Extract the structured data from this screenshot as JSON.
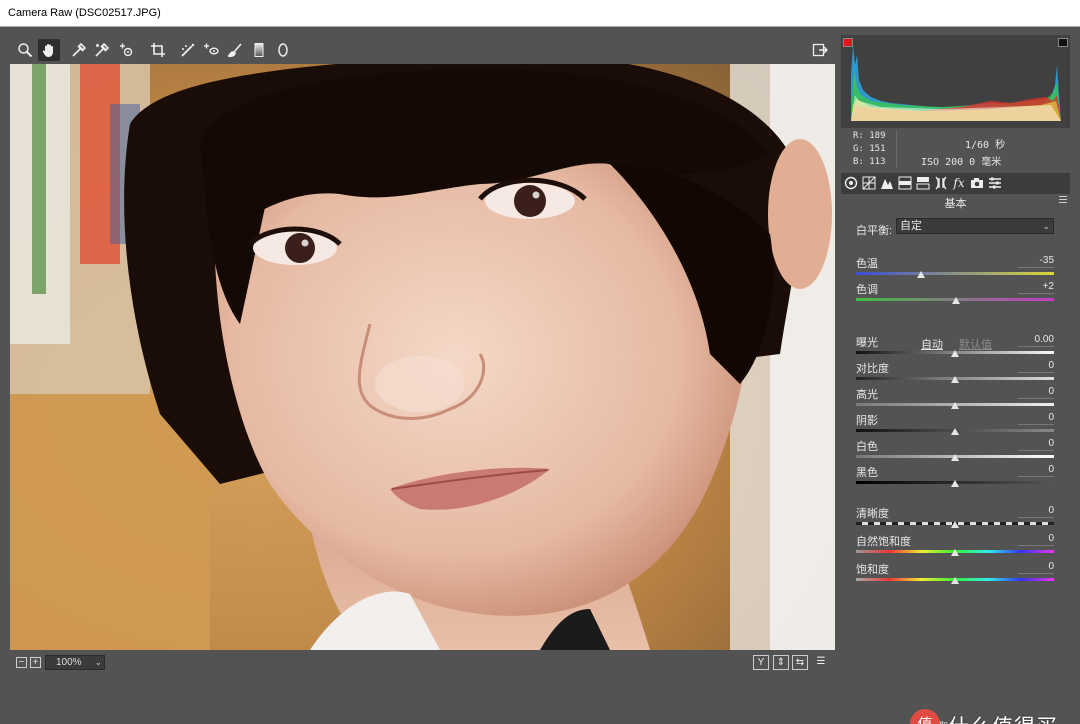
{
  "window": {
    "title": "Camera Raw (DSC02517.JPG)"
  },
  "toolbar": {
    "tools": [
      "zoom-icon",
      "hand-icon",
      "white-balance-icon",
      "color-sampler-icon",
      "targeted-adjustment-icon",
      "crop-icon",
      "straighten-icon",
      "spot-removal-icon",
      "red-eye-icon",
      "adjustment-brush-icon",
      "graduated-filter-icon",
      "radial-filter-icon"
    ],
    "active_tool": "hand-icon"
  },
  "bottombar": {
    "zoom_out": "−",
    "zoom_in": "+",
    "zoom_value": "100%",
    "compare_icons": [
      "Y",
      "⇕",
      "⇆",
      "☰"
    ]
  },
  "info": {
    "r": "R:  189",
    "g": "G:  151",
    "b": "B:  113",
    "shutter": "1/60 秒",
    "iso": "ISO 200  0 毫米"
  },
  "panel": {
    "section_title": "基本",
    "wb_label": "白平衡:",
    "wb_value": "自定",
    "auto_label": "自动",
    "default_label": "默认值",
    "sliders": [
      {
        "key": "temp",
        "label": "色温",
        "value": "-35",
        "position": 0.33
      },
      {
        "key": "tint",
        "label": "色调",
        "value": "+2",
        "position": 0.505
      },
      {
        "key": "exposure",
        "label": "曝光",
        "value": "0.00",
        "position": 0.5
      },
      {
        "key": "contrast",
        "label": "对比度",
        "value": "0",
        "position": 0.5
      },
      {
        "key": "highlights",
        "label": "高光",
        "value": "0",
        "position": 0.5
      },
      {
        "key": "shadows",
        "label": "阴影",
        "value": "0",
        "position": 0.5
      },
      {
        "key": "whites",
        "label": "白色",
        "value": "0",
        "position": 0.5
      },
      {
        "key": "blacks",
        "label": "黑色",
        "value": "0",
        "position": 0.5
      },
      {
        "key": "clarity",
        "label": "清晰度",
        "value": "0",
        "position": 0.5
      },
      {
        "key": "vibrance",
        "label": "自然饱和度",
        "value": "0",
        "position": 0.5
      },
      {
        "key": "saturation",
        "label": "饱和度",
        "value": "0",
        "position": 0.5
      }
    ]
  },
  "watermark": {
    "badge": "值",
    "text": "什么值得买",
    "sub": "取"
  },
  "colors": {
    "panel_bg": "#535353",
    "dark_bg": "#3c3c3c",
    "clip_red": "#e0181a"
  }
}
